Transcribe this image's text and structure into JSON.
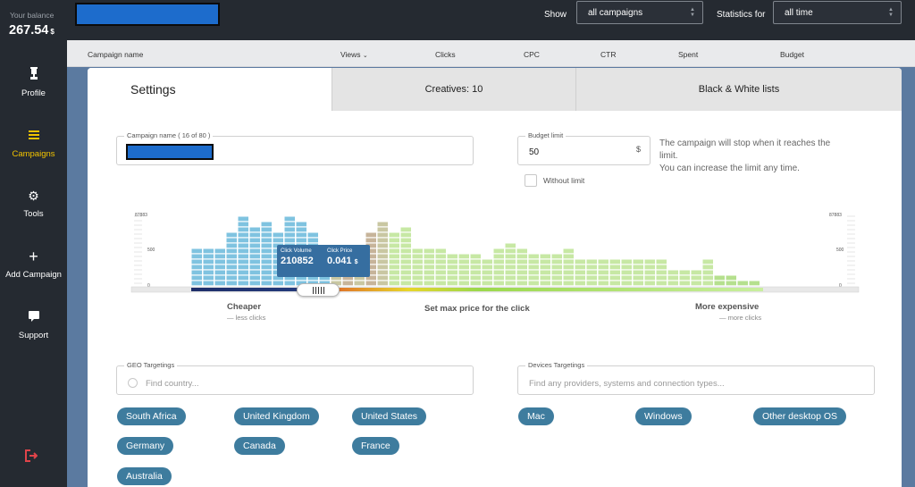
{
  "sidebar": {
    "balance_label": "Your balance",
    "balance_value": "267.54",
    "balance_currency": "$",
    "items": [
      {
        "label": "Profile",
        "icon": "trophy-icon"
      },
      {
        "label": "Campaigns",
        "icon": "menu-icon",
        "active": true
      },
      {
        "label": "Tools",
        "icon": "gear-icon"
      },
      {
        "label": "Add Campaign",
        "icon": "plus-icon"
      },
      {
        "label": "Support",
        "icon": "chat-icon"
      }
    ],
    "logout_icon": "logout-icon"
  },
  "topbar": {
    "show_label": "Show",
    "show_value": "all campaigns",
    "stats_label": "Statistics for",
    "stats_value": "all time"
  },
  "columns": [
    "Campaign name",
    "Views",
    "Clicks",
    "CPC",
    "CTR",
    "Spent",
    "Budget"
  ],
  "tabs": {
    "settings": "Settings",
    "creatives": "Creatives: 10",
    "lists": "Black & White lists"
  },
  "form": {
    "campaign_name_label": "Campaign name ( 16 of 80 )",
    "budget_label": "Budget limit",
    "budget_value": "50",
    "budget_currency": "$",
    "budget_hint_1": "The campaign will stop when it reaches the",
    "budget_hint_2": "limit.",
    "budget_hint_3": "You can increase the limit any time.",
    "without_limit": "Without limit"
  },
  "price_slider": {
    "axis_top": "87883",
    "axis_mid": "500",
    "axis_zero": "0",
    "click_volume_label": "Click Volume",
    "click_volume": "210852",
    "click_price_label": "Click Price",
    "click_price": "0.041",
    "click_price_currency": "$",
    "left_caption": "Cheaper",
    "left_sub": "— less clicks",
    "center_caption": "Set max price for the click",
    "right_caption": "More expensive",
    "right_sub": "— more clicks",
    "bars": [
      7,
      7,
      7,
      10,
      13,
      11,
      12,
      10,
      13,
      12,
      10,
      7,
      7,
      6,
      7,
      10,
      12,
      10,
      11,
      7,
      7,
      7,
      6,
      6,
      6,
      5,
      7,
      8,
      7,
      6,
      6,
      6,
      7,
      5,
      5,
      5,
      5,
      5,
      5,
      5,
      5,
      3,
      3,
      3,
      5,
      2,
      2,
      1,
      1
    ],
    "selected_count": 12,
    "colors": {
      "selected": "#7fc3e0",
      "mid_a": "#c7b49a",
      "mid_b": "#c9c7a2",
      "green": "#c7e8a4",
      "edge": "#b5e08e"
    }
  },
  "geo": {
    "label": "GEO Targetings",
    "placeholder": "Find country...",
    "tags": [
      "South Africa",
      "United Kingdom",
      "United States",
      "Germany",
      "Canada",
      "France",
      "Australia"
    ]
  },
  "devices": {
    "label": "Devices Targetings",
    "placeholder": "Find any providers, systems and connection types...",
    "tags": [
      "Mac",
      "Windows",
      "Other desktop OS"
    ]
  }
}
